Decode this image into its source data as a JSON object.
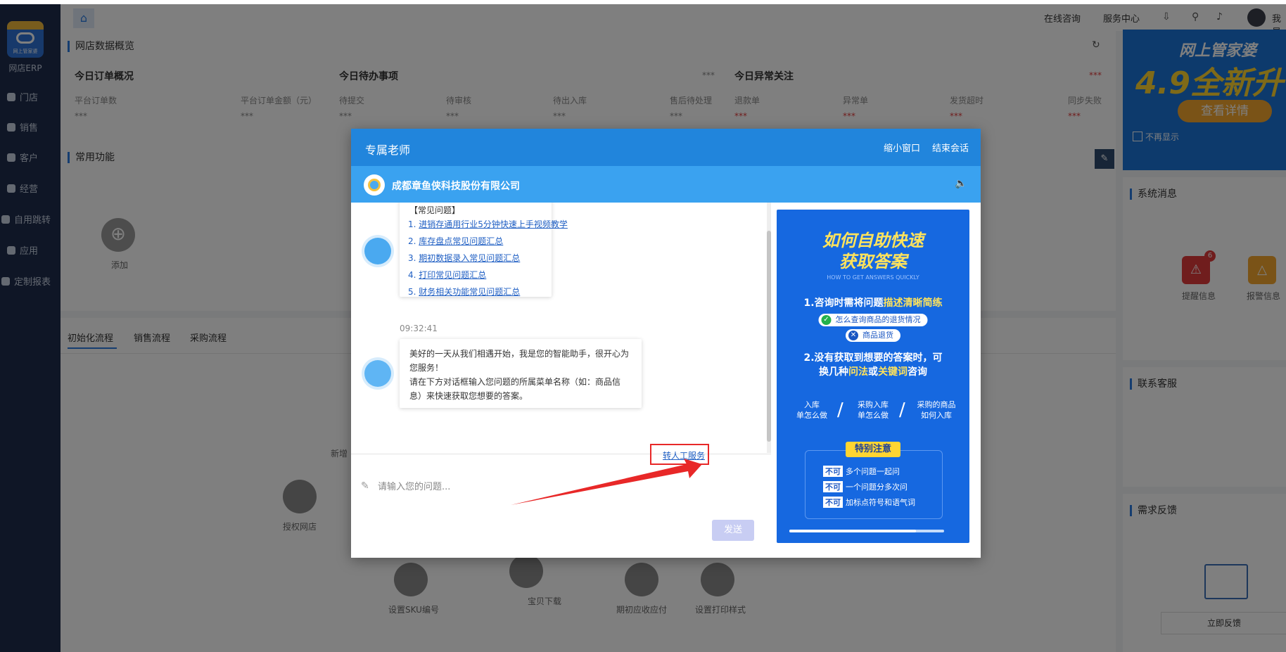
{
  "app": {
    "name": "网店ERP",
    "logo_text": "网上管家婆"
  },
  "sidebar": {
    "items": [
      {
        "label": "门店",
        "icon": "store-icon"
      },
      {
        "label": "销售",
        "icon": "sales-icon"
      },
      {
        "label": "客户",
        "icon": "customer-icon"
      },
      {
        "label": "经营",
        "icon": "business-icon"
      },
      {
        "label": "自用跳转",
        "icon": "redirect-icon"
      },
      {
        "label": "应用",
        "icon": "apps-icon"
      },
      {
        "label": "定制报表",
        "icon": "report-icon"
      }
    ]
  },
  "topbar": {
    "home_icon": "⌂",
    "links": [
      "在线咨询",
      "服务中心"
    ],
    "user_label": "我是"
  },
  "overview": {
    "title": "网店数据概览",
    "today_orders": {
      "title": "今日订单概况",
      "fields": [
        "平台订单数",
        "平台订单金额（元）"
      ],
      "values": [
        "***",
        "***"
      ]
    },
    "todo": {
      "title": "今日待办事项",
      "stars": "***",
      "fields": [
        "待提交",
        "待审核",
        "待出入库",
        "售后待处理"
      ],
      "values": [
        "***",
        "***",
        "***",
        "***"
      ]
    },
    "abnormal": {
      "title": "今日异常关注",
      "stars": "***",
      "fields": [
        "退款单",
        "异常单",
        "发货超时",
        "同步失败"
      ],
      "values": [
        "***",
        "***",
        "***",
        "***"
      ]
    }
  },
  "common_functions": {
    "title": "常用功能",
    "add_label": "添加"
  },
  "flow_tabs": [
    "初始化流程",
    "销售流程",
    "采购流程"
  ],
  "flow_steps": [
    "新增",
    "授权网店",
    "设置SKU编号",
    "宝贝下载",
    "期初应收应付",
    "设置打印样式"
  ],
  "right_column": {
    "banner": {
      "headline": "网上管家婆",
      "big": "4.9全新升",
      "button": "查看详情",
      "dont_show": "不再显示"
    },
    "system_messages": "系统消息",
    "reminder_label": "提醒信息",
    "reminder_count": "6",
    "warning_label": "报警信息",
    "contact_service": "联系客服",
    "feedback": "需求反馈",
    "feedback_button": "立即反馈"
  },
  "dialog": {
    "title": "专属老师",
    "minimize": "缩小窗口",
    "end_session": "结束会话",
    "company": "成都章鱼侠科技股份有限公司",
    "faq": {
      "header": "【常见问题】",
      "items": [
        {
          "num": "1.",
          "text": "进销存通用行业5分钟快速上手视频教学"
        },
        {
          "num": "2.",
          "text": "库存盘点常见问题汇总"
        },
        {
          "num": "3.",
          "text": "期初数据录入常见问题汇总"
        },
        {
          "num": "4.",
          "text": "打印常见问题汇总"
        },
        {
          "num": "5.",
          "text": "财务相关功能常见问题汇总"
        }
      ]
    },
    "timestamp": "09:32:41",
    "welcome_lines": [
      "美好的一天从我们相遇开始，我是您的智能助手，很开心为",
      "您服务！",
      "请在下方对话框输入您问题的所属菜单名称（如：商品信",
      "息）来快速获取您想要的答案。"
    ],
    "transfer_label": "转人工服务",
    "input_placeholder": "请输入您的问题...",
    "send_label": "发送",
    "promo": {
      "title_line1": "如何自助快速",
      "title_line2": "获取答案",
      "subtitle_en": "HOW TO GET ANSWERS QUICKLY",
      "tip1_prefix": "1.咨询时需将问题",
      "tip1_highlight": "描述清晰简练",
      "good_example": "怎么查询商品的退货情况",
      "bad_example": "商品退货",
      "tip2_line1": "2.没有获取到想要的答案时，可",
      "tip2_pre": "换几种",
      "tip2_h1": "问法",
      "tip2_mid": "或",
      "tip2_h2": "关键词",
      "tip2_post": "咨询",
      "examples": [
        {
          "l1": "入库",
          "l2": "单怎么做"
        },
        {
          "l1": "采购入库",
          "l2": "单怎么做"
        },
        {
          "l1": "采购的商品",
          "l2": "如何入库"
        }
      ],
      "special_note": "特别注意",
      "rule_tag": "不可",
      "rules": [
        "多个问题一起问",
        "一个问题分多次问",
        "加标点符号和语气词"
      ],
      "progress": 0.82
    }
  },
  "colors": {
    "accent": "#2185dc",
    "sidebar": "#1e2d4d",
    "highlight_red": "#e82828"
  }
}
